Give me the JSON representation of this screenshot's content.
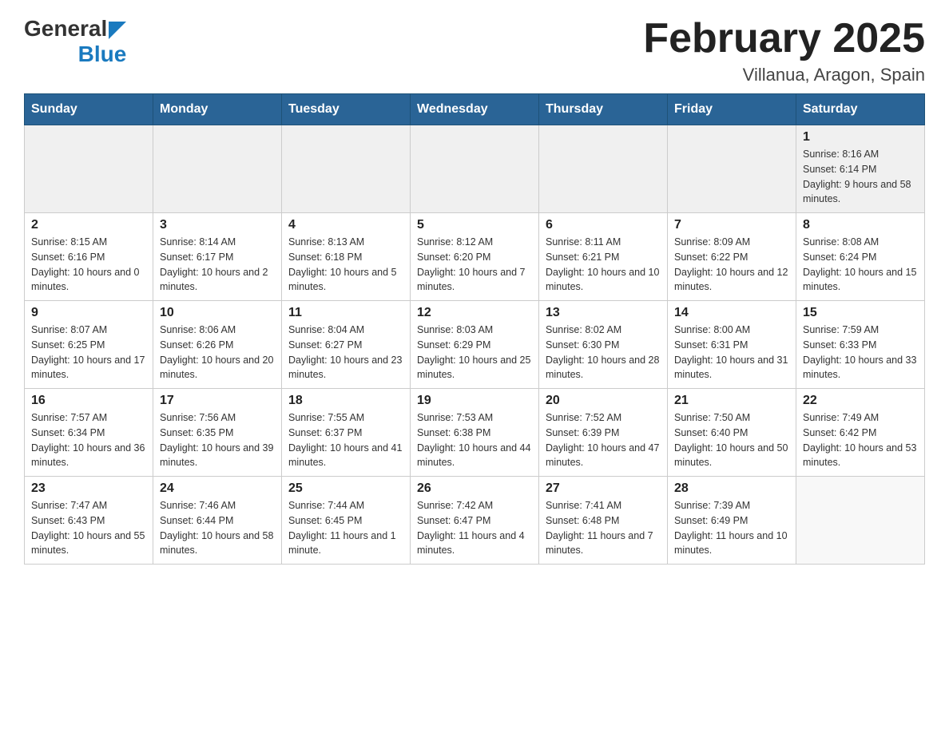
{
  "header": {
    "logo_general": "General",
    "logo_blue": "Blue",
    "title": "February 2025",
    "subtitle": "Villanua, Aragon, Spain"
  },
  "weekdays": [
    "Sunday",
    "Monday",
    "Tuesday",
    "Wednesday",
    "Thursday",
    "Friday",
    "Saturday"
  ],
  "weeks": [
    [
      {
        "day": "",
        "info": ""
      },
      {
        "day": "",
        "info": ""
      },
      {
        "day": "",
        "info": ""
      },
      {
        "day": "",
        "info": ""
      },
      {
        "day": "",
        "info": ""
      },
      {
        "day": "",
        "info": ""
      },
      {
        "day": "1",
        "info": "Sunrise: 8:16 AM\nSunset: 6:14 PM\nDaylight: 9 hours and 58 minutes."
      }
    ],
    [
      {
        "day": "2",
        "info": "Sunrise: 8:15 AM\nSunset: 6:16 PM\nDaylight: 10 hours and 0 minutes."
      },
      {
        "day": "3",
        "info": "Sunrise: 8:14 AM\nSunset: 6:17 PM\nDaylight: 10 hours and 2 minutes."
      },
      {
        "day": "4",
        "info": "Sunrise: 8:13 AM\nSunset: 6:18 PM\nDaylight: 10 hours and 5 minutes."
      },
      {
        "day": "5",
        "info": "Sunrise: 8:12 AM\nSunset: 6:20 PM\nDaylight: 10 hours and 7 minutes."
      },
      {
        "day": "6",
        "info": "Sunrise: 8:11 AM\nSunset: 6:21 PM\nDaylight: 10 hours and 10 minutes."
      },
      {
        "day": "7",
        "info": "Sunrise: 8:09 AM\nSunset: 6:22 PM\nDaylight: 10 hours and 12 minutes."
      },
      {
        "day": "8",
        "info": "Sunrise: 8:08 AM\nSunset: 6:24 PM\nDaylight: 10 hours and 15 minutes."
      }
    ],
    [
      {
        "day": "9",
        "info": "Sunrise: 8:07 AM\nSunset: 6:25 PM\nDaylight: 10 hours and 17 minutes."
      },
      {
        "day": "10",
        "info": "Sunrise: 8:06 AM\nSunset: 6:26 PM\nDaylight: 10 hours and 20 minutes."
      },
      {
        "day": "11",
        "info": "Sunrise: 8:04 AM\nSunset: 6:27 PM\nDaylight: 10 hours and 23 minutes."
      },
      {
        "day": "12",
        "info": "Sunrise: 8:03 AM\nSunset: 6:29 PM\nDaylight: 10 hours and 25 minutes."
      },
      {
        "day": "13",
        "info": "Sunrise: 8:02 AM\nSunset: 6:30 PM\nDaylight: 10 hours and 28 minutes."
      },
      {
        "day": "14",
        "info": "Sunrise: 8:00 AM\nSunset: 6:31 PM\nDaylight: 10 hours and 31 minutes."
      },
      {
        "day": "15",
        "info": "Sunrise: 7:59 AM\nSunset: 6:33 PM\nDaylight: 10 hours and 33 minutes."
      }
    ],
    [
      {
        "day": "16",
        "info": "Sunrise: 7:57 AM\nSunset: 6:34 PM\nDaylight: 10 hours and 36 minutes."
      },
      {
        "day": "17",
        "info": "Sunrise: 7:56 AM\nSunset: 6:35 PM\nDaylight: 10 hours and 39 minutes."
      },
      {
        "day": "18",
        "info": "Sunrise: 7:55 AM\nSunset: 6:37 PM\nDaylight: 10 hours and 41 minutes."
      },
      {
        "day": "19",
        "info": "Sunrise: 7:53 AM\nSunset: 6:38 PM\nDaylight: 10 hours and 44 minutes."
      },
      {
        "day": "20",
        "info": "Sunrise: 7:52 AM\nSunset: 6:39 PM\nDaylight: 10 hours and 47 minutes."
      },
      {
        "day": "21",
        "info": "Sunrise: 7:50 AM\nSunset: 6:40 PM\nDaylight: 10 hours and 50 minutes."
      },
      {
        "day": "22",
        "info": "Sunrise: 7:49 AM\nSunset: 6:42 PM\nDaylight: 10 hours and 53 minutes."
      }
    ],
    [
      {
        "day": "23",
        "info": "Sunrise: 7:47 AM\nSunset: 6:43 PM\nDaylight: 10 hours and 55 minutes."
      },
      {
        "day": "24",
        "info": "Sunrise: 7:46 AM\nSunset: 6:44 PM\nDaylight: 10 hours and 58 minutes."
      },
      {
        "day": "25",
        "info": "Sunrise: 7:44 AM\nSunset: 6:45 PM\nDaylight: 11 hours and 1 minute."
      },
      {
        "day": "26",
        "info": "Sunrise: 7:42 AM\nSunset: 6:47 PM\nDaylight: 11 hours and 4 minutes."
      },
      {
        "day": "27",
        "info": "Sunrise: 7:41 AM\nSunset: 6:48 PM\nDaylight: 11 hours and 7 minutes."
      },
      {
        "day": "28",
        "info": "Sunrise: 7:39 AM\nSunset: 6:49 PM\nDaylight: 11 hours and 10 minutes."
      },
      {
        "day": "",
        "info": ""
      }
    ]
  ]
}
